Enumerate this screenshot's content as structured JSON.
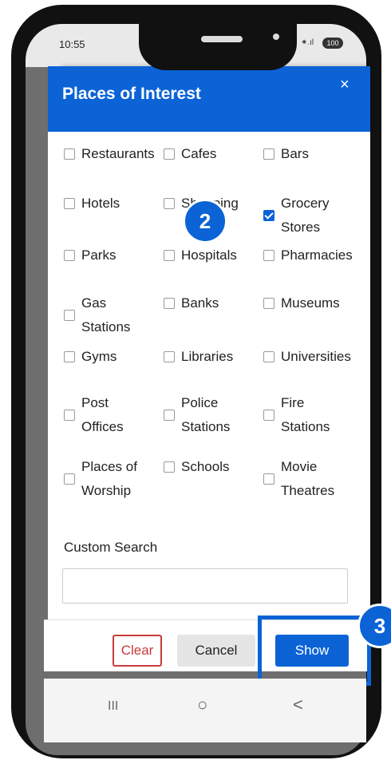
{
  "status_bar": {
    "time": "10:55",
    "signal": "⁕.ıl",
    "battery": "100"
  },
  "dialog": {
    "title": "Places of Interest",
    "close_glyph": "×",
    "options": [
      {
        "label": "Restaurants",
        "checked": false
      },
      {
        "label": "Cafes",
        "checked": false
      },
      {
        "label": "Bars",
        "checked": false
      },
      {
        "label": "Hotels",
        "checked": false
      },
      {
        "label": "Shopping",
        "checked": false
      },
      {
        "label": "Grocery Stores",
        "checked": true
      },
      {
        "label": "Parks",
        "checked": false
      },
      {
        "label": "Hospitals",
        "checked": false
      },
      {
        "label": "Pharmacies",
        "checked": false
      },
      {
        "label": "Gas Stations",
        "checked": false
      },
      {
        "label": "Banks",
        "checked": false
      },
      {
        "label": "Museums",
        "checked": false
      },
      {
        "label": "Gyms",
        "checked": false
      },
      {
        "label": "Libraries",
        "checked": false
      },
      {
        "label": "Universities",
        "checked": false
      },
      {
        "label": "Post Offices",
        "checked": false
      },
      {
        "label": "Police Stations",
        "checked": false
      },
      {
        "label": "Fire Stations",
        "checked": false
      },
      {
        "label": "Places of Worship",
        "checked": false
      },
      {
        "label": "Schools",
        "checked": false
      },
      {
        "label": "Movie Theatres",
        "checked": false
      }
    ],
    "custom_search_label": "Custom Search",
    "custom_search_value": "",
    "buttons": {
      "clear": "Clear",
      "cancel": "Cancel",
      "show": "Show"
    }
  },
  "steps": {
    "two": "2",
    "three": "3"
  },
  "navbar": {
    "recents": "III",
    "home": "○",
    "back": "<"
  },
  "colors": {
    "accent": "#0b63d6",
    "clear": "#c93a3a"
  }
}
